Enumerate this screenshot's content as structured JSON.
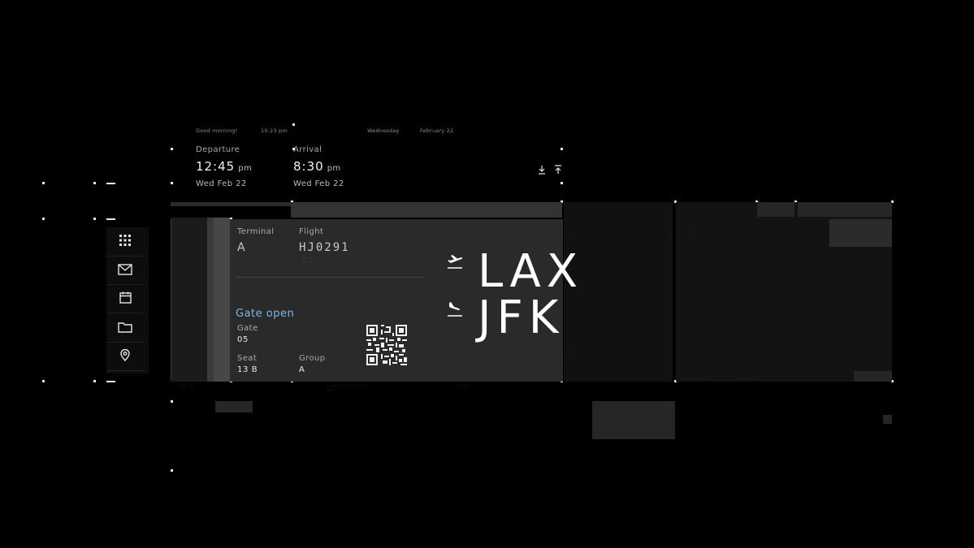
{
  "header": {
    "greeting": "Good morning!",
    "clock": "10:23 pm",
    "weekday": "Wednesday",
    "date": "February 22"
  },
  "departure": {
    "label": "Departure",
    "time": "12:45",
    "ampm": "pm",
    "date": "Wed Feb 22"
  },
  "arrival": {
    "label": "Arrival",
    "time": "8:30",
    "ampm": "pm",
    "date": "Wed Feb 22"
  },
  "toolbar": {
    "icons": [
      "download-icon",
      "upload-icon"
    ]
  },
  "sidebar": {
    "items": [
      {
        "icon": "apps-grid-icon"
      },
      {
        "icon": "mail-icon"
      },
      {
        "icon": "calendar-icon"
      },
      {
        "icon": "folder-icon"
      },
      {
        "icon": "location-pin-icon"
      }
    ]
  },
  "ticket": {
    "terminal_label": "Terminal",
    "terminal_value": "A",
    "flight_label": "Flight",
    "flight_value": "HJ0291",
    "status": "Gate open",
    "gate_label": "Gate",
    "gate_value": "05",
    "seat_label": "Seat",
    "seat_value": "13 B",
    "group_label": "Group",
    "group_value": "A",
    "origin": "LAX",
    "destination": "JFK",
    "departure_icon": "takeoff-icon",
    "arrival_icon": "landing-icon"
  },
  "colors": {
    "background": "#000000",
    "panel": "#2a2a2a",
    "status_accent": "#78b9e6",
    "text_primary": "#ffffff"
  }
}
